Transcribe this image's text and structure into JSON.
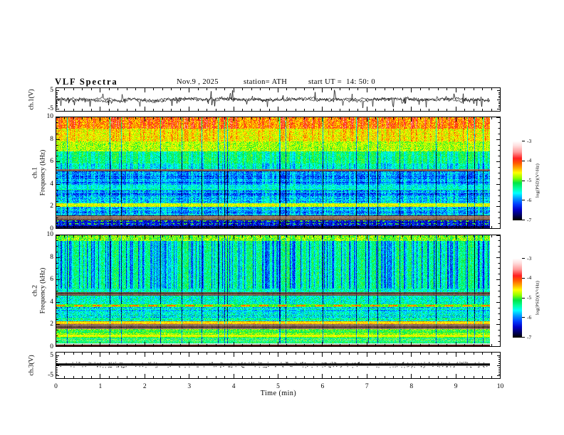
{
  "header": {
    "title": "VLF Spectra",
    "date": "Nov.9 , 2025",
    "station": "station= ATH",
    "start_ut": "start UT =  14: 50: 0"
  },
  "chart_data": {
    "type": "heatmap",
    "description": "Multi-panel VLF spectra display: ch.1 voltage waveform, ch.1 spectrogram, ch.2 spectrogram, ch.3 voltage trace vs time",
    "xaxis": {
      "label": "Time (min)",
      "min": 0,
      "max": 10,
      "tick_labels": [
        "0",
        "1",
        "2",
        "3",
        "4",
        "5",
        "6",
        "7",
        "8",
        "9",
        "10"
      ],
      "minor_step": 0.2,
      "data_end_min": 9.78
    },
    "colorbar": {
      "label": "log(PSD)(V²/Hz)",
      "tick_labels": [
        "-3",
        "-4",
        "-5",
        "-6",
        "-7"
      ],
      "range_top": -3,
      "range_bottom": -7,
      "palette": [
        [
          0.0,
          "#ffffff"
        ],
        [
          0.06,
          "#ffdede"
        ],
        [
          0.14,
          "#ff9a9a"
        ],
        [
          0.22,
          "#ff2020"
        ],
        [
          0.28,
          "#ff5a00"
        ],
        [
          0.34,
          "#ffa800"
        ],
        [
          0.4,
          "#ffff00"
        ],
        [
          0.47,
          "#8cff00"
        ],
        [
          0.53,
          "#00e646"
        ],
        [
          0.6,
          "#00ffa0"
        ],
        [
          0.66,
          "#00ffff"
        ],
        [
          0.73,
          "#0096ff"
        ],
        [
          0.8,
          "#003cff"
        ],
        [
          0.87,
          "#0000c8"
        ],
        [
          0.93,
          "#00006e"
        ],
        [
          1.0,
          "#000000"
        ]
      ]
    },
    "panels": {
      "ch1_wave": {
        "ylabel": "ch.1(V)",
        "type": "waveform",
        "ytick_labels": [
          "5",
          "-5"
        ],
        "ytick_values": [
          5,
          -5
        ],
        "yrange": [
          -6.25,
          6.25
        ],
        "mean_v": 0,
        "noise_v": 0.9,
        "spike_v": 5.0,
        "spike_rate": 0.05
      },
      "ch1_spec": {
        "ylabel_line1": "ch.1",
        "ylabel_line2": "Frequency (kHz)",
        "type": "spectrogram",
        "ytick_labels": [
          "10",
          "8",
          "6",
          "4",
          "2",
          "0"
        ],
        "freq_range_khz": [
          0,
          10
        ],
        "bands": [
          {
            "f": [
              8.9,
              10.0
            ],
            "t": 0.35,
            "noise": 0.09,
            "streak": -0.18,
            "src": "A"
          },
          {
            "f": [
              7.8,
              8.9
            ],
            "t": 0.42,
            "noise": 0.08,
            "streak": -0.11,
            "src": "A"
          },
          {
            "f": [
              6.9,
              7.8
            ],
            "t": 0.47,
            "noise": 0.07,
            "streak": -0.07,
            "src": "A"
          },
          {
            "f": [
              5.8,
              6.9
            ],
            "t": 0.52,
            "noise": 0.07,
            "streak": 0.16,
            "src": "B"
          },
          {
            "f": [
              5.3,
              5.8
            ],
            "t": 0.57,
            "noise": 0.07,
            "streak": 0.18,
            "src": "B"
          },
          {
            "f": [
              5.15,
              5.3
            ],
            "special": "gray"
          },
          {
            "f": [
              3.9,
              5.15
            ],
            "t": 0.79,
            "noise": 0.08,
            "streak": -0.13,
            "src": "B",
            "rowvar": 0.05
          },
          {
            "f": [
              3.55,
              3.9
            ],
            "t": 0.68,
            "noise": 0.07,
            "streak": -0.08,
            "src": "B"
          },
          {
            "f": [
              3.45,
              3.55
            ],
            "t": 0.58,
            "noise": 0.05
          },
          {
            "f": [
              2.3,
              3.45
            ],
            "t": 0.77,
            "noise": 0.09,
            "streak": -0.13,
            "src": "B",
            "rowvar": 0.06
          },
          {
            "f": [
              1.95,
              2.3
            ],
            "t": 0.44,
            "noise": 0.06,
            "streak": -0.04,
            "src": "B"
          },
          {
            "f": [
              1.2,
              1.95
            ],
            "t": 0.77,
            "noise": 0.09,
            "streak": -0.13,
            "src": "B",
            "rowvar": 0.06
          },
          {
            "f": [
              0.78,
              1.2
            ],
            "special": "gray"
          },
          {
            "f": [
              0.25,
              0.78
            ],
            "t": 0.88,
            "noise": 0.06,
            "streak": -0.08,
            "src": "B",
            "gdash": 0.35
          },
          {
            "f": [
              0.0,
              0.25
            ],
            "t": 0.95,
            "noise": 0.04,
            "gdash": 0.08
          }
        ]
      },
      "ch2_spec": {
        "ylabel_line1": "ch.2",
        "ylabel_line2": "Frequency (kHz)",
        "type": "spectrogram",
        "ytick_labels": [
          "10",
          "8",
          "6",
          "4",
          "2",
          "0"
        ],
        "freq_range_khz": [
          0,
          10
        ],
        "bands": [
          {
            "f": [
              9.4,
              10.0
            ],
            "t": 0.45,
            "noise": 0.08,
            "streak": 0.08,
            "src": "B"
          },
          {
            "f": [
              5.2,
              9.4
            ],
            "t": 0.53,
            "noise": 0.07,
            "streak": 0.3,
            "src": "B"
          },
          {
            "f": [
              4.87,
              5.2
            ],
            "t": 0.58,
            "noise": 0.08,
            "streak": 0.1,
            "src": "B"
          },
          {
            "f": [
              4.55,
              4.87
            ],
            "special": "gray"
          },
          {
            "f": [
              3.8,
              4.55
            ],
            "t": 0.6,
            "noise": 0.1,
            "streak": 0.07,
            "src": "B"
          },
          {
            "f": [
              3.55,
              3.8
            ],
            "dash": true,
            "t": 0.31,
            "t2": 0.5,
            "noise": 0.05
          },
          {
            "f": [
              2.28,
              3.55
            ],
            "t": 0.63,
            "noise": 0.09,
            "streak": 0.06,
            "src": "B",
            "rowvar": 0.08
          },
          {
            "f": [
              2.03,
              2.28
            ],
            "t": 0.38,
            "noise": 0.05,
            "rowvar": 0.05
          },
          {
            "f": [
              1.58,
              2.03
            ],
            "special": "gray"
          },
          {
            "f": [
              1.08,
              1.58
            ],
            "t": 0.5,
            "noise": 0.07,
            "rowvar": 0.08
          },
          {
            "f": [
              0.89,
              1.08
            ],
            "t": 0.41,
            "noise": 0.05
          },
          {
            "f": [
              0.32,
              0.89
            ],
            "t": 0.52,
            "noise": 0.07,
            "rowvar": 0.13
          },
          {
            "f": [
              0.19,
              0.32
            ],
            "special": "light"
          },
          {
            "f": [
              0.0,
              0.19
            ],
            "special": "darkred"
          }
        ]
      },
      "ch3_wave": {
        "ylabel": "ch.3(V)",
        "type": "flatline",
        "ytick_labels": [
          "5",
          "-5"
        ],
        "ytick_values": [
          5,
          -5
        ],
        "yrange": [
          -6.25,
          6.25
        ],
        "value_v": 0.4,
        "thickness_v": 1.1
      }
    }
  }
}
